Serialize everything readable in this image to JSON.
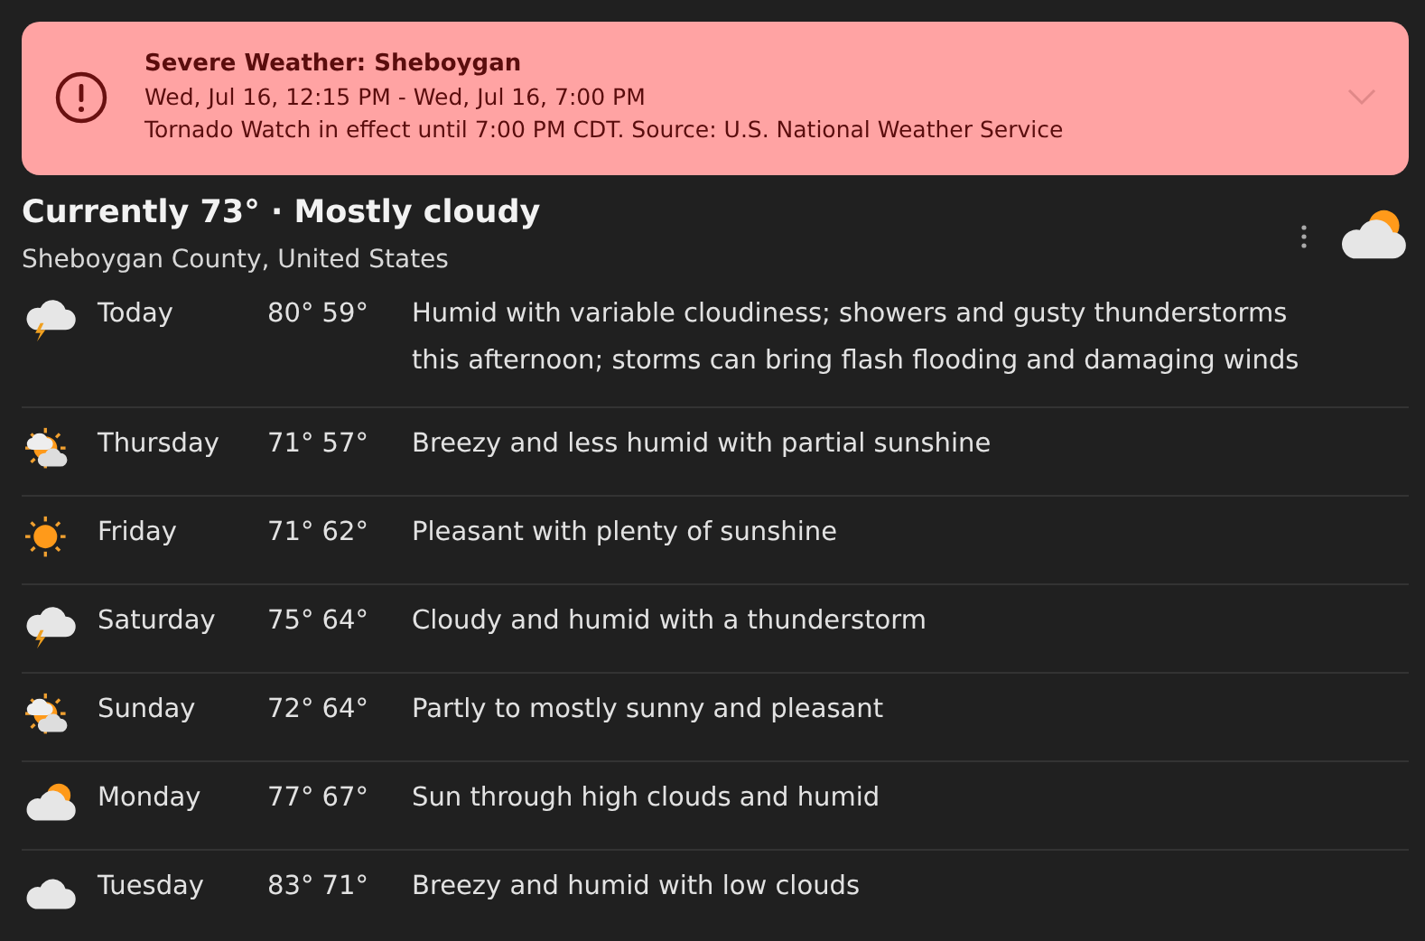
{
  "alert": {
    "title": "Severe Weather: Sheboygan",
    "time_range": "Wed, Jul 16, 12:15 PM - Wed, Jul 16, 7:00 PM",
    "message": "Tornado Watch in effect until 7:00 PM CDT. Source: U.S. National Weather Service",
    "expanded": false
  },
  "current": {
    "summary": "Currently 73° · Mostly cloudy",
    "location": "Sheboygan County, United States",
    "kind": "mostly-cloudy"
  },
  "forecast": [
    {
      "day": "Today",
      "temps": "80° 59°",
      "description": "Humid with variable cloudiness; showers and gusty thunderstorms this afternoon; storms can bring flash flooding and damaging winds",
      "kind": "storm"
    },
    {
      "day": "Thursday",
      "temps": "71° 57°",
      "description": "Breezy and less humid with partial sunshine",
      "kind": "partly-sunny"
    },
    {
      "day": "Friday",
      "temps": "71° 62°",
      "description": "Pleasant with plenty of sunshine",
      "kind": "sunny"
    },
    {
      "day": "Saturday",
      "temps": "75° 64°",
      "description": "Cloudy and humid with a thunderstorm",
      "kind": "storm"
    },
    {
      "day": "Sunday",
      "temps": "72° 64°",
      "description": "Partly to mostly sunny and pleasant",
      "kind": "partly-sunny"
    },
    {
      "day": "Monday",
      "temps": "77° 67°",
      "description": "Sun through high clouds and humid",
      "kind": "mostly-cloudy"
    },
    {
      "day": "Tuesday",
      "temps": "83° 71°",
      "description": "Breezy and humid with low clouds",
      "kind": "cloudy"
    }
  ]
}
